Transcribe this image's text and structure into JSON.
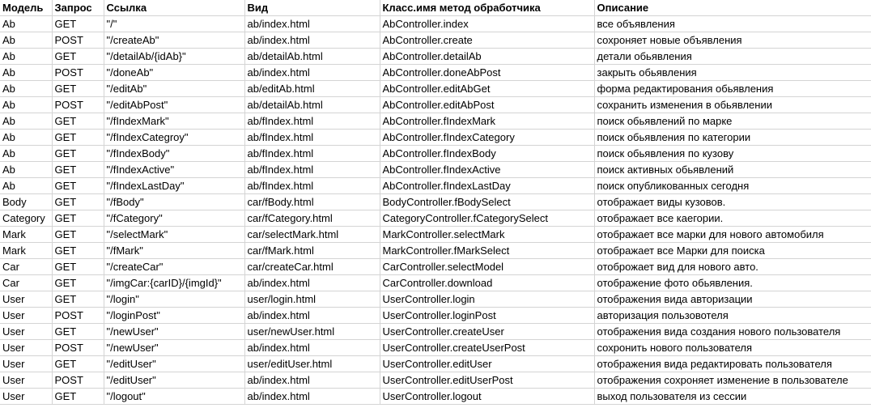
{
  "headers": [
    "Модель",
    "Запрос",
    "Ссылка",
    "Вид",
    "Класс.имя метод обработчика",
    "Описание"
  ],
  "rows": [
    [
      "Ab",
      "GET",
      "\"/\"",
      "ab/index.html",
      "AbController.index",
      "все объявления"
    ],
    [
      "Ab",
      "POST",
      "\"/createAb\"",
      "ab/index.html",
      "AbController.create",
      "сохроняет новые объявления"
    ],
    [
      "Ab",
      "GET",
      "\"/detailAb/{idAb}\"",
      "ab/detailAb.html",
      "AbController.detailAb",
      "детали обьявления"
    ],
    [
      "Ab",
      "POST",
      "\"/doneAb\"",
      "ab/index.html",
      "AbController.doneAbPost",
      "закрыть обьявления"
    ],
    [
      "Ab",
      "GET",
      "\"/editAb\"",
      "ab/editAb.html",
      "AbController.editAbGet",
      "форма редактирования обьявления"
    ],
    [
      "Ab",
      "POST",
      "\"/editAbPost\"",
      "ab/detailAb.html",
      "AbController.editAbPost",
      "сохранить изменения в обьявлении"
    ],
    [
      "Ab",
      "GET",
      "\"/fIndexMark\"",
      "ab/fIndex.html",
      "AbController.fIndexMark",
      "поиск обьявлений по марке"
    ],
    [
      "Ab",
      "GET",
      "\"/fIndexCategroy\"",
      "ab/fIndex.html",
      "AbController.fIndexCategory",
      "поиск обьявления по категории"
    ],
    [
      "Ab",
      "GET",
      "\"/fIndexBody\"",
      "ab/fIndex.html",
      "AbController.fIndexBody",
      "поиск обьявления по кузову"
    ],
    [
      "Ab",
      "GET",
      "\"/fIndexActive\"",
      "ab/fIndex.html",
      "AbController.fIndexActive",
      "поиск активных обьявлений"
    ],
    [
      "Ab",
      "GET",
      "\"/fIndexLastDay\"",
      "ab/fIndex.html",
      "AbController.fIndexLastDay",
      "поиск опубликованных сегодня"
    ],
    [
      "Body",
      "GET",
      "\"/fBody\"",
      "car/fBody.html",
      "BodyController.fBodySelect",
      "отображает виды кузовов."
    ],
    [
      "Category",
      "GET",
      "\"/fCategory\"",
      "car/fCategory.html",
      "CategoryController.fCategorySelect",
      "отображает все каегории."
    ],
    [
      "Mark",
      "GET",
      "\"/selectMark\"",
      "car/selectMark.html",
      "MarkController.selectMark",
      "отображает все марки для нового автомобиля"
    ],
    [
      "Mark",
      "GET",
      "\"/fMark\"",
      "car/fMark.html",
      "MarkController.fMarkSelect",
      "отображает все Марки для поиска"
    ],
    [
      "Car",
      "GET",
      "\"/createCar\"",
      "car/createCar.html",
      "CarController.selectModel",
      "отоброжает вид для нового авто."
    ],
    [
      "Car",
      "GET",
      "\"/imgCar:{carID}/{imgId}\"",
      "ab/index.html",
      "CarController.download",
      "отображение фото обьявления."
    ],
    [
      "User",
      "GET",
      "\"/login\"",
      "user/login.html",
      "UserController.login",
      "отображения вида авторизации"
    ],
    [
      "User",
      "POST",
      "\"/loginPost\"",
      "ab/index.html",
      "UserController.loginPost",
      "авторизация пользовотеля"
    ],
    [
      "User",
      "GET",
      "\"/newUser\"",
      "user/newUser.html",
      "UserController.createUser",
      "отображения вида создания нового пользователя"
    ],
    [
      "User",
      "POST",
      "\"/newUser\"",
      "ab/index.html",
      "UserController.createUserPost",
      "сохронить нового пользователя"
    ],
    [
      "User",
      "GET",
      "\"/editUser\"",
      "user/editUser.html",
      "UserController.editUser",
      "отображения вида редактировать пользователя"
    ],
    [
      "User",
      "POST",
      "\"/editUser\"",
      "ab/index.html",
      "UserController.editUserPost",
      "отображения сохроняет изменение в пользователе"
    ],
    [
      "User",
      "GET",
      "\"/logout\"",
      "ab/index.html",
      "UserController.logout",
      "выход пользователя из сессии"
    ]
  ]
}
